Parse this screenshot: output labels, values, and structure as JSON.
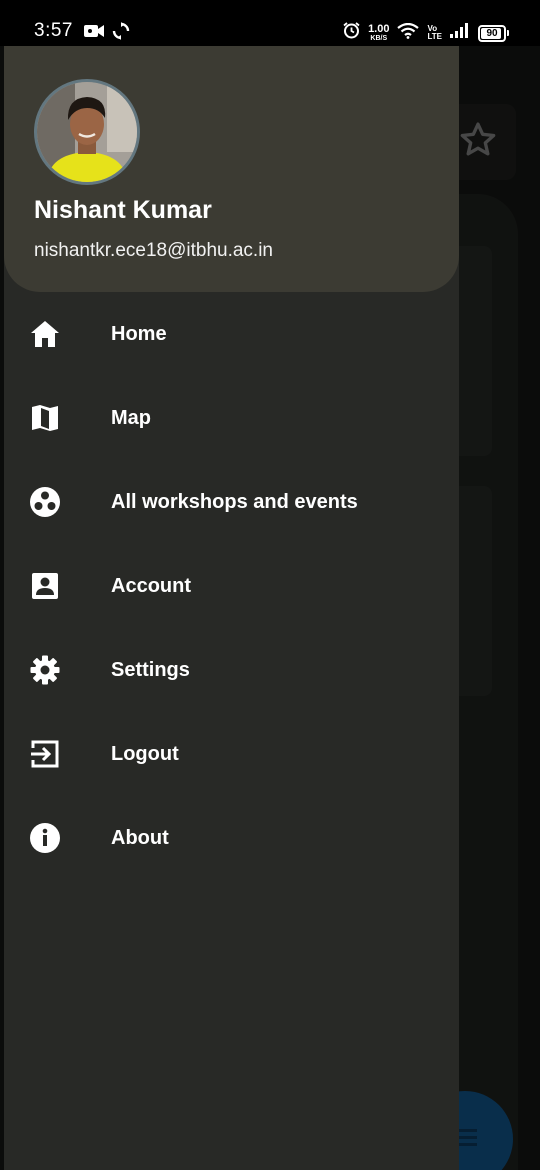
{
  "status_bar": {
    "time": "3:57",
    "net_speed_value": "1.00",
    "net_speed_unit": "KB/S",
    "volte_top": "Vo",
    "volte_bottom": "LTE",
    "battery": "90"
  },
  "drawer": {
    "user_name": "Nishant Kumar",
    "user_email": "nishantkr.ece18@itbhu.ac.in",
    "items": [
      {
        "label": "Home",
        "icon": "home-icon"
      },
      {
        "label": "Map",
        "icon": "map-icon"
      },
      {
        "label": "All workshops and events",
        "icon": "events-icon"
      },
      {
        "label": "Account",
        "icon": "account-box-icon"
      },
      {
        "label": "Settings",
        "icon": "gear-icon"
      },
      {
        "label": "Logout",
        "icon": "logout-icon"
      },
      {
        "label": "About",
        "icon": "info-icon"
      }
    ]
  },
  "colors": {
    "drawer_bg": "#282926",
    "header_bg": "#3c3b33",
    "fab": "#0e4774"
  }
}
